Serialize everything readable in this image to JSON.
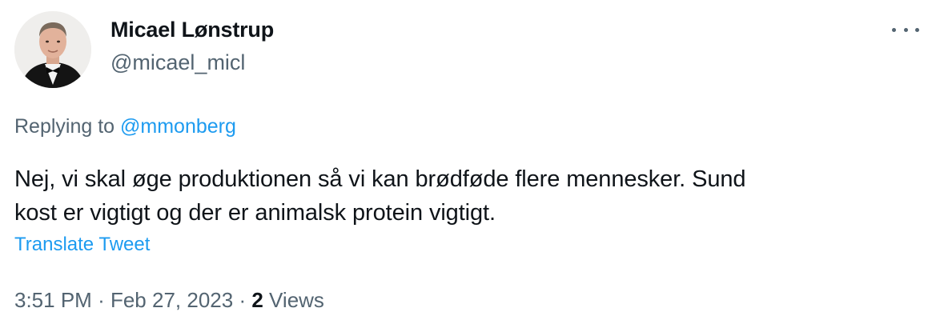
{
  "author": {
    "display_name": "Micael Lønstrup",
    "handle": "@micael_micl"
  },
  "reply": {
    "prefix": "Replying to",
    "mention": "@mmonberg"
  },
  "tweet": {
    "text_line1": "Nej, vi skal øge produktionen så vi kan brødføde flere mennesker. Sund",
    "text_line2": "kost er vigtigt og der er animalsk protein vigtigt.",
    "translate_label": "Translate Tweet"
  },
  "meta": {
    "time": "3:51 PM",
    "separator": "·",
    "date": "Feb 27, 2023",
    "views_count": "2",
    "views_label": "Views"
  },
  "icons": {
    "more": "more-dots-icon",
    "avatar": "profile-avatar"
  },
  "colors": {
    "link": "#1d9bf0",
    "secondary_text": "#536471",
    "primary_text": "#0f1419"
  }
}
